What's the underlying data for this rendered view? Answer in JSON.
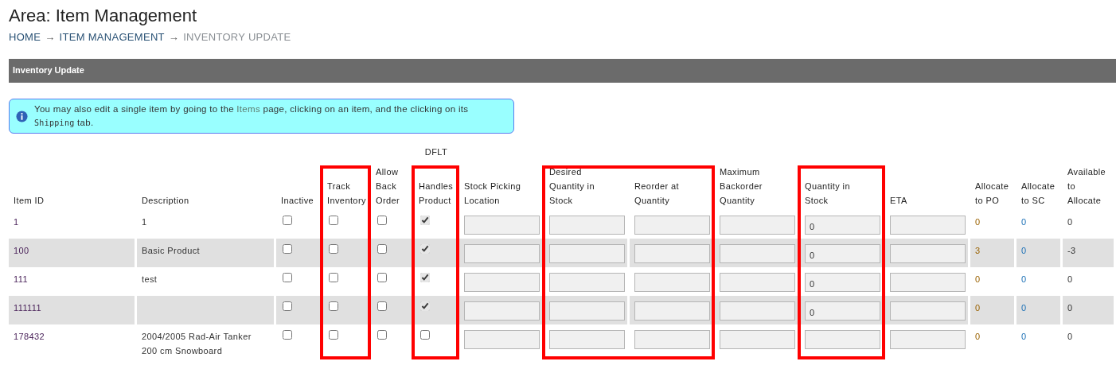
{
  "page_title": "Area: Item Management",
  "breadcrumb": [
    {
      "label": "HOME",
      "kind": "link"
    },
    {
      "label": "→",
      "kind": "separator"
    },
    {
      "label": "ITEM MANAGEMENT",
      "kind": "link"
    },
    {
      "label": "→",
      "kind": "separator"
    },
    {
      "label": "INVENTORY UPDATE",
      "kind": "current"
    }
  ],
  "panel_title": "Inventory Update",
  "info_message": {
    "before": "You may also edit a single item by going to the ",
    "link": "Items",
    "middle": " page, clicking on an item, and the clicking on its ",
    "code": "Shipping",
    "after": " tab."
  },
  "columns": [
    {
      "label": "Item ID",
      "kind": "id"
    },
    {
      "label": "Description",
      "kind": "text"
    },
    {
      "label": "Inactive",
      "kind": "checkbox"
    },
    {
      "label": "Track Inventory",
      "kind": "checkbox"
    },
    {
      "label": "Allow Back Order",
      "kind": "checkbox"
    },
    {
      "label": "Handles Product",
      "kind": "checkbox",
      "group_label": "DFLT"
    },
    {
      "label": "Stock Picking Location",
      "kind": "input"
    },
    {
      "label": "Desired Quantity in Stock",
      "kind": "input"
    },
    {
      "label": "Reorder at Quantity",
      "kind": "input"
    },
    {
      "label": "Maximum Backorder Quantity",
      "kind": "input"
    },
    {
      "label": "Quantity in Stock",
      "kind": "input"
    },
    {
      "label": "ETA",
      "kind": "input"
    },
    {
      "label": "Allocate to PO",
      "kind": "po"
    },
    {
      "label": "Allocate to SC",
      "kind": "sc"
    },
    {
      "label": "Available to Allocate",
      "kind": "available"
    }
  ],
  "rows": [
    {
      "cells": [
        {
          "text": "1"
        },
        {
          "text": "1"
        },
        {
          "checked": false
        },
        {
          "checked": false
        },
        {
          "checked": false
        },
        {
          "checked": true
        },
        {},
        {},
        {},
        {},
        {
          "value": "0"
        },
        {},
        {
          "text": "0"
        },
        {
          "text": "0"
        },
        {
          "text": "0"
        }
      ]
    },
    {
      "cells": [
        {
          "text": "100"
        },
        {
          "text": "Basic Product"
        },
        {
          "checked": false
        },
        {
          "checked": false
        },
        {
          "checked": false
        },
        {
          "checked": true
        },
        {},
        {},
        {},
        {},
        {
          "value": "0"
        },
        {},
        {
          "text": "3"
        },
        {
          "text": "0"
        },
        {
          "text": "-3"
        }
      ]
    },
    {
      "cells": [
        {
          "text": "111"
        },
        {
          "text": "test"
        },
        {
          "checked": false
        },
        {
          "checked": false
        },
        {
          "checked": false
        },
        {
          "checked": true
        },
        {},
        {},
        {},
        {},
        {
          "value": "0"
        },
        {},
        {
          "text": "0"
        },
        {
          "text": "0"
        },
        {
          "text": "0"
        }
      ]
    },
    {
      "cells": [
        {
          "text": "111111"
        },
        {},
        {
          "checked": false
        },
        {
          "checked": false
        },
        {
          "checked": false
        },
        {
          "checked": true
        },
        {},
        {},
        {},
        {},
        {
          "value": "0"
        },
        {},
        {
          "text": "0"
        },
        {
          "text": "0"
        },
        {
          "text": "0"
        }
      ]
    },
    {
      "cells": [
        {
          "text": "178432"
        },
        {
          "text": "2004/2005 Rad-Air Tanker 200 cm Snowboard"
        },
        {
          "checked": false
        },
        {
          "checked": false
        },
        {
          "checked": false
        },
        {
          "checked": false
        },
        {},
        {},
        {},
        {},
        {},
        {},
        {
          "text": "0"
        },
        {
          "text": "0"
        },
        {
          "text": "0"
        }
      ]
    }
  ],
  "annotations": [
    {
      "kind": "highlight-box"
    },
    {
      "kind": "highlight-box"
    },
    {
      "kind": "highlight-box"
    },
    {
      "kind": "highlight-box"
    }
  ]
}
